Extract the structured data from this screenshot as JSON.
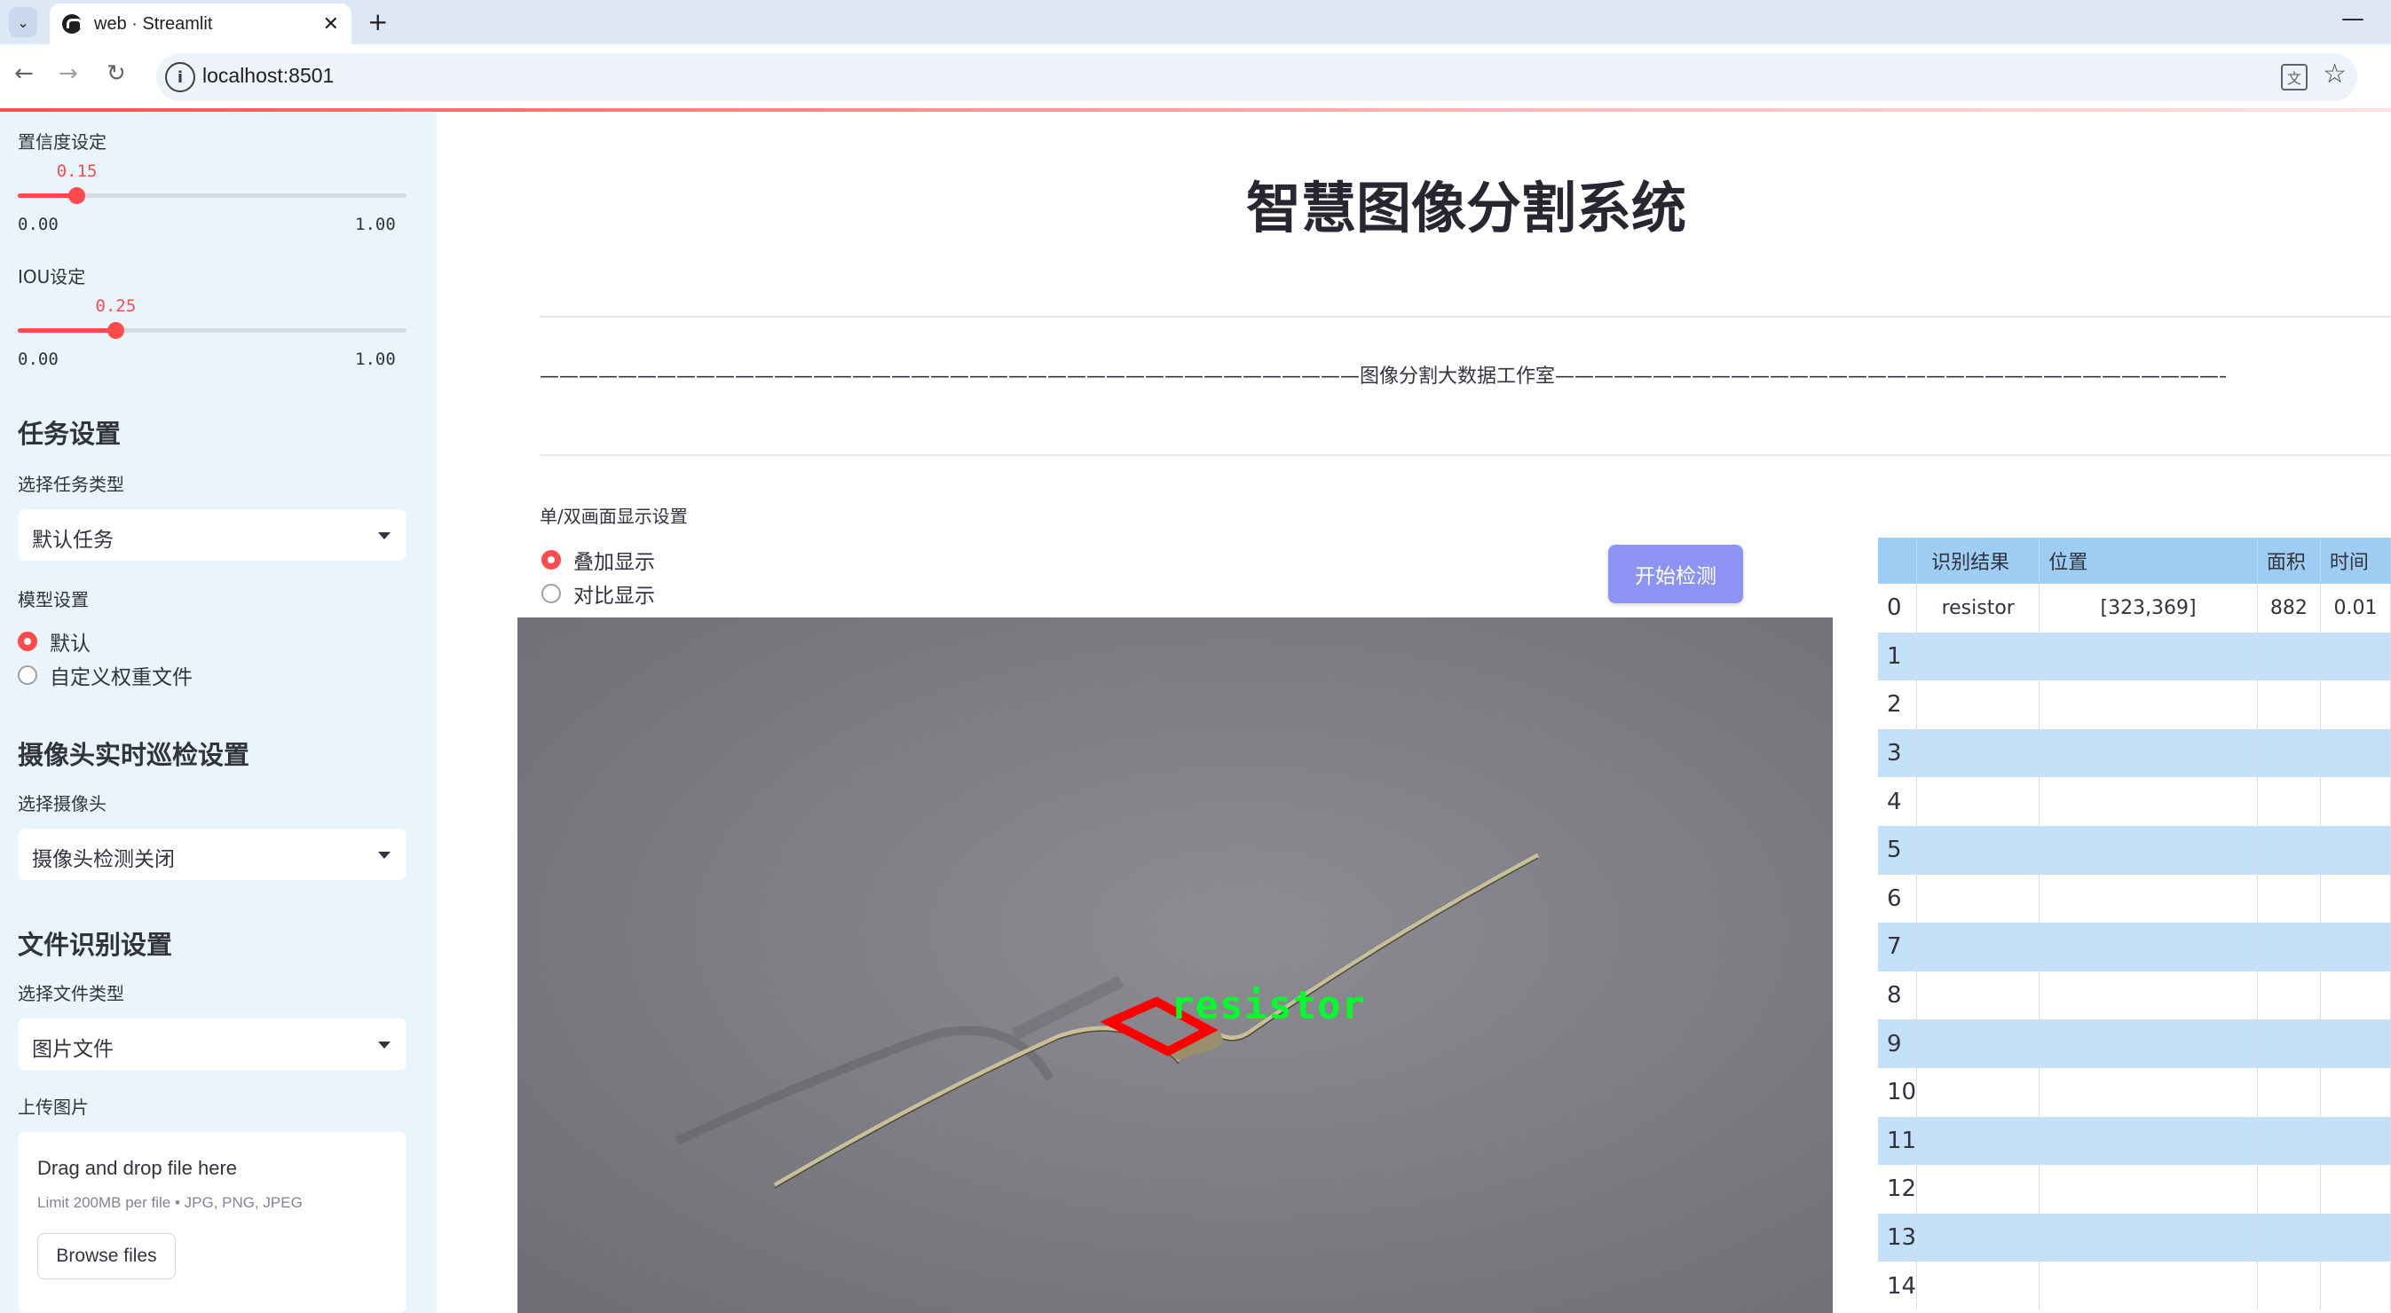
{
  "browser": {
    "tab_title": "web · Streamlit",
    "url": "localhost:8501",
    "new_tab_symbol": "+",
    "close_symbol": "✕",
    "minimize_symbol": "—"
  },
  "sidebar": {
    "confidence": {
      "label": "置信度设定",
      "value": "0.15",
      "level": 0.15,
      "min": "0.00",
      "max": "1.00"
    },
    "iou": {
      "label": "IOU设定",
      "value": "0.25",
      "level": 0.25,
      "min": "0.00",
      "max": "1.00"
    },
    "task_header": "任务设置",
    "task_type_label": "选择任务类型",
    "task_type_value": "默认任务",
    "model_label": "模型设置",
    "model_options": [
      "默认",
      "自定义权重文件"
    ],
    "model_selected": 0,
    "camera_header": "摄像头实时巡检设置",
    "camera_label": "选择摄像头",
    "camera_value": "摄像头检测关闭",
    "file_header": "文件识别设置",
    "file_type_label": "选择文件类型",
    "file_type_value": "图片文件",
    "upload_label": "上传图片",
    "upload_title": "Drag and drop file here",
    "upload_limit": "Limit 200MB per file • JPG, PNG, JPEG",
    "browse_button": "Browse files"
  },
  "main": {
    "title": "智慧图像分割系统",
    "subtitle": "——————————————————————————————————————————图像分割大数据工作室——————————————————————————————————————————",
    "display_label": "单/双画面显示设置",
    "display_options": [
      "叠加显示",
      "对比显示"
    ],
    "display_selected": 0,
    "detect_button": "开始检测",
    "detection_label": "resistor"
  },
  "results_table": {
    "columns": [
      "",
      "识别结果",
      "位置",
      "面积",
      "时间"
    ],
    "rows": [
      [
        "0",
        "resistor",
        "[323,369]",
        "882",
        "0.01"
      ],
      [
        "1",
        "",
        "",
        "",
        ""
      ],
      [
        "2",
        "",
        "",
        "",
        ""
      ],
      [
        "3",
        "",
        "",
        "",
        ""
      ],
      [
        "4",
        "",
        "",
        "",
        ""
      ],
      [
        "5",
        "",
        "",
        "",
        ""
      ],
      [
        "6",
        "",
        "",
        "",
        ""
      ],
      [
        "7",
        "",
        "",
        "",
        ""
      ],
      [
        "8",
        "",
        "",
        "",
        ""
      ],
      [
        "9",
        "",
        "",
        "",
        ""
      ],
      [
        "10",
        "",
        "",
        "",
        ""
      ],
      [
        "11",
        "",
        "",
        "",
        ""
      ],
      [
        "12",
        "",
        "",
        "",
        ""
      ],
      [
        "13",
        "",
        "",
        "",
        ""
      ],
      [
        "14",
        "",
        "",
        "",
        ""
      ]
    ]
  },
  "colors": {
    "accent": "#ff4b4b",
    "sidebar_bg": "#eaf4fb",
    "button_bg": "#8c93f2",
    "table_header": "#9ecdf3",
    "table_alt_row": "#c4e0f8",
    "detection_box": "#ff0000",
    "detection_text": "#00ff2a"
  }
}
